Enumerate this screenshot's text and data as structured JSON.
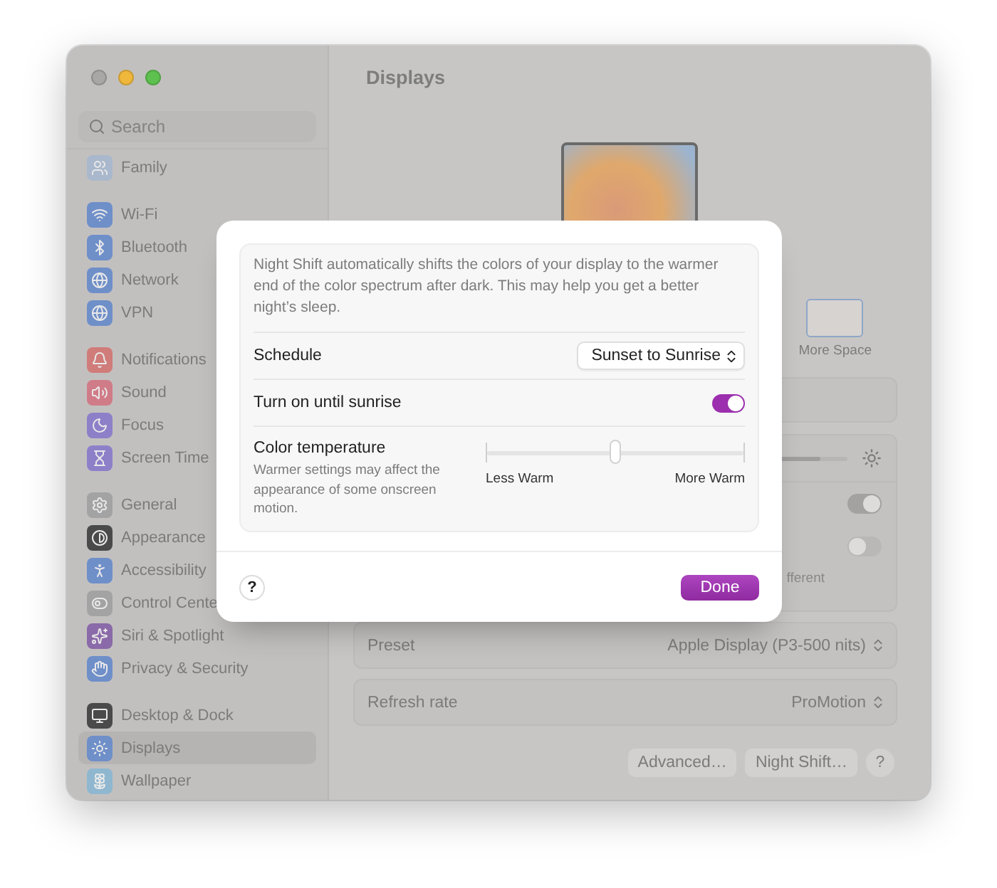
{
  "sidebar": {
    "search": {
      "placeholder": "Search"
    },
    "groups": [
      {
        "items": [
          {
            "label": "Family",
            "color": "#a9b8cc",
            "selected": false
          }
        ]
      },
      {
        "items": [
          {
            "label": "Wi-Fi",
            "color": "#6f8fc9",
            "selected": false
          },
          {
            "label": "Bluetooth",
            "color": "#6f8fc9",
            "selected": false
          },
          {
            "label": "Network",
            "color": "#6f8fc9",
            "selected": false
          },
          {
            "label": "VPN",
            "color": "#6f8fc9",
            "selected": false
          }
        ]
      },
      {
        "items": [
          {
            "label": "Notifications",
            "color": "#d07c7a",
            "selected": false
          },
          {
            "label": "Sound",
            "color": "#d07c88",
            "selected": false
          },
          {
            "label": "Focus",
            "color": "#8d80c9",
            "selected": false
          },
          {
            "label": "Screen Time",
            "color": "#8d80c9",
            "selected": false
          }
        ]
      },
      {
        "items": [
          {
            "label": "General",
            "color": "#a3a3a3",
            "selected": false
          },
          {
            "label": "Appearance",
            "color": "#4a4a4a",
            "selected": false
          },
          {
            "label": "Accessibility",
            "color": "#6f8fc9",
            "selected": false
          },
          {
            "label": "Control Cente",
            "color": "#a3a3a3",
            "selected": false
          },
          {
            "label": "Siri & Spotlight",
            "color": "#8a6aa8",
            "selected": false
          },
          {
            "label": "Privacy & Security",
            "color": "#6f8fc9",
            "selected": false
          }
        ]
      },
      {
        "items": [
          {
            "label": "Desktop & Dock",
            "color": "#4a4a4a",
            "selected": false
          },
          {
            "label": "Displays",
            "color": "#6f8fc9",
            "selected": true
          },
          {
            "label": "Wallpaper",
            "color": "#8fb7d0",
            "selected": false
          }
        ]
      }
    ]
  },
  "main": {
    "title": "Displays",
    "arrangement_option": {
      "label": "More Space"
    },
    "brightness": {
      "level": 0.9
    },
    "toggles": [
      {
        "on": true
      },
      {
        "on": false,
        "caption": "fferent"
      }
    ],
    "preset": {
      "label": "Preset",
      "value": "Apple Display (P3-500 nits)"
    },
    "refresh_rate": {
      "label": "Refresh rate",
      "value": "ProMotion"
    },
    "buttons": [
      {
        "label": "Advanced…",
        "kind": "text"
      },
      {
        "label": "Night Shift…",
        "kind": "text"
      },
      {
        "label": "?",
        "kind": "help"
      }
    ]
  },
  "sheet": {
    "description": "Night Shift automatically shifts the colors of your display to the warmer end of the color spectrum after dark. This may help you get a better night’s sleep.",
    "schedule": {
      "label": "Schedule",
      "value": "Sunset to Sunrise"
    },
    "until_sunrise": {
      "label": "Turn on until sunrise",
      "on": true
    },
    "color_temperature": {
      "label": "Color temperature",
      "note": "Warmer settings may affect the appearance of some onscreen motion.",
      "level": 0.5,
      "min_label": "Less Warm",
      "max_label": "More Warm"
    },
    "help": "?",
    "done": "Done"
  }
}
